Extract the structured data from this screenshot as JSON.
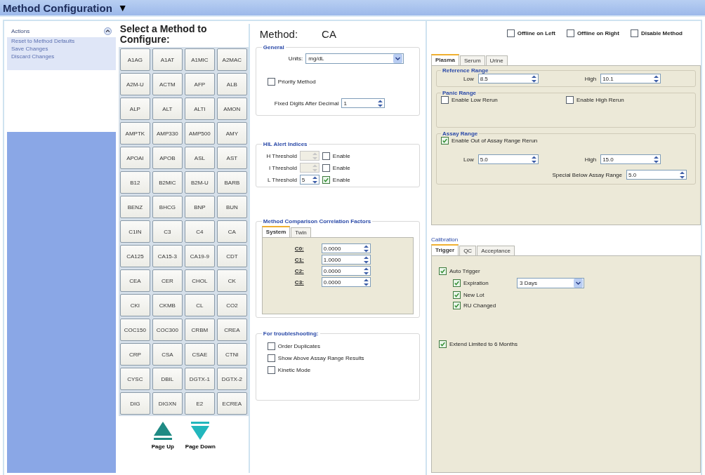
{
  "header": {
    "title": "Method Configuration",
    "caret": "▼"
  },
  "actions": {
    "title": "Actions",
    "items": [
      "Reset to Method Defaults",
      "Save Changes",
      "Discard Changes"
    ]
  },
  "method_picker": {
    "title": "Select a Method to Configure:",
    "methods": [
      "A1AG",
      "A1AT",
      "A1MIC",
      "A2MAC",
      "A2M-U",
      "ACTM",
      "AFP",
      "ALB",
      "ALP",
      "ALT",
      "ALTI",
      "AMON",
      "AMPTK",
      "AMP330",
      "AMP500",
      "AMY",
      "APOAI",
      "APOB",
      "ASL",
      "AST",
      "B12",
      "B2MIC",
      "B2M-U",
      "BARB",
      "BENZ",
      "BHCG",
      "BNP",
      "BUN",
      "C1IN",
      "C3",
      "C4",
      "CA",
      "CA125",
      "CA15-3",
      "CA19-9",
      "CDT",
      "CEA",
      "CER",
      "CHOL",
      "CK",
      "CKI",
      "CKMB",
      "CL",
      "CO2",
      "COC150",
      "COC300",
      "CRBM",
      "CREA",
      "CRP",
      "CSA",
      "CSAE",
      "CTNI",
      "CYSC",
      "DBIL",
      "DGTX-1",
      "DGTX-2",
      "DIG",
      "DIGXN",
      "E2",
      "ECREA"
    ],
    "page_up": "Page Up",
    "page_down": "Page Down"
  },
  "method": {
    "label": "Method:",
    "value": "CA"
  },
  "top_options": [
    {
      "label": "Offline on Left",
      "checked": false
    },
    {
      "label": "Offline on Right",
      "checked": false
    },
    {
      "label": "Disable Method",
      "checked": false
    }
  ],
  "general": {
    "title": "General",
    "units_label": "Units:",
    "units": "mg/dL",
    "priority": {
      "label": "Priority Method",
      "checked": false
    },
    "digits_label": "Fixed Digits After Decimal",
    "digits": "1"
  },
  "hil": {
    "title": "HIL Alert Indices",
    "rows": [
      {
        "label": "H Threshold",
        "disabled": true,
        "enable_label": "Enable",
        "checked": false
      },
      {
        "label": "I Threshold",
        "disabled": true,
        "enable_label": "Enable",
        "checked": false
      },
      {
        "label": "L Threshold",
        "value": "5",
        "disabled": false,
        "enable_label": "Enable",
        "checked": true
      }
    ]
  },
  "correlation": {
    "title": "Method Comparison Correlation Factors",
    "tabs": [
      {
        "label": "System",
        "selected": true
      },
      {
        "label": "Twin",
        "selected": false
      }
    ],
    "factors": [
      {
        "label": "C0:",
        "value": "0.0000"
      },
      {
        "label": "C1:",
        "value": "1.0000"
      },
      {
        "label": "C2:",
        "value": "0.0000"
      },
      {
        "label": "C3:",
        "value": "0.0000"
      }
    ]
  },
  "troubleshooting": {
    "title": "For troubleshooting:",
    "options": [
      {
        "label": "Order Duplicates",
        "checked": false
      },
      {
        "label": "Show Above Assay Range Results",
        "checked": false
      },
      {
        "label": "Kinetic Mode",
        "checked": false
      }
    ]
  },
  "sample_tabs": [
    {
      "label": "Plasma",
      "selected": true
    },
    {
      "label": "Serum",
      "selected": false
    },
    {
      "label": "Urine",
      "selected": false
    }
  ],
  "reference_range": {
    "title": "Reference Range",
    "low_label": "Low",
    "low": "8.5",
    "high_label": "High",
    "high": "10.1"
  },
  "panic_range": {
    "title": "Panic Range",
    "options": [
      {
        "label": "Enable Low Rerun",
        "checked": false
      },
      {
        "label": "Enable High Rerun",
        "checked": false
      }
    ]
  },
  "assay_range": {
    "title": "Assay Range",
    "rerun": {
      "label": "Enable Out of Assay Range Rerun",
      "checked": true
    },
    "low_label": "Low",
    "low": "5.0",
    "high_label": "High",
    "high": "15.0",
    "special_label": "Special Below Assay Range",
    "special": "5.0"
  },
  "calibration": {
    "title": "Calibration",
    "tabs": [
      {
        "label": "Trigger",
        "selected": true
      },
      {
        "label": "QC",
        "selected": false
      },
      {
        "label": "Acceptance",
        "selected": false
      }
    ],
    "auto_trigger": {
      "label": "Auto Trigger",
      "checked": true
    },
    "triggers": [
      {
        "label": "Expiration",
        "checked": true,
        "dropdown": "3 Days"
      },
      {
        "label": "New Lot",
        "checked": true
      },
      {
        "label": "RU Changed",
        "checked": true
      }
    ],
    "extend": {
      "label": "Extend Limited to 6 Months",
      "checked": true
    }
  }
}
